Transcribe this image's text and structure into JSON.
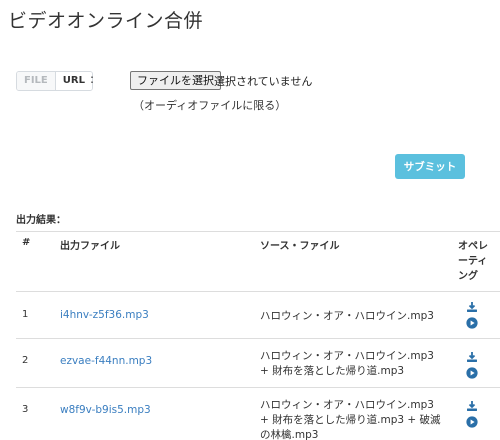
{
  "page": {
    "title": "ビデオオンライン合併"
  },
  "source_toggle": {
    "file_label": "FILE",
    "url_label": "URL",
    "separator": ":"
  },
  "upload": {
    "choose_button": "ファイルを選択",
    "status": "選択されていません",
    "note": "（オーディオファイルに限る）"
  },
  "submit_label": "サブミット",
  "results": {
    "label": "出力結果：",
    "headers": {
      "num": "#",
      "output": "出力ファイル",
      "source": "ソース・ファイル",
      "ops": "オペレーティング"
    },
    "rows": [
      {
        "num": "1",
        "output": "i4hnv-z5f36.mp3",
        "source": "ハロウィン・オア・ハロウイン.mp3"
      },
      {
        "num": "2",
        "output": "ezvae-f44nn.mp3",
        "source": "ハロウィン・オア・ハロウイン.mp3 + 財布を落とした帰り道.mp3"
      },
      {
        "num": "3",
        "output": "w8f9v-b9is5.mp3",
        "source": "ハロウィン・オア・ハロウイン.mp3 + 財布を落とした帰り道.mp3 + 破滅の林檎.mp3"
      }
    ]
  },
  "icons": {
    "download": "download-icon",
    "play": "play-circle-icon"
  },
  "colors": {
    "accent": "#5bc0de",
    "link": "#3a7ec0",
    "icon": "#2a6fa8"
  }
}
